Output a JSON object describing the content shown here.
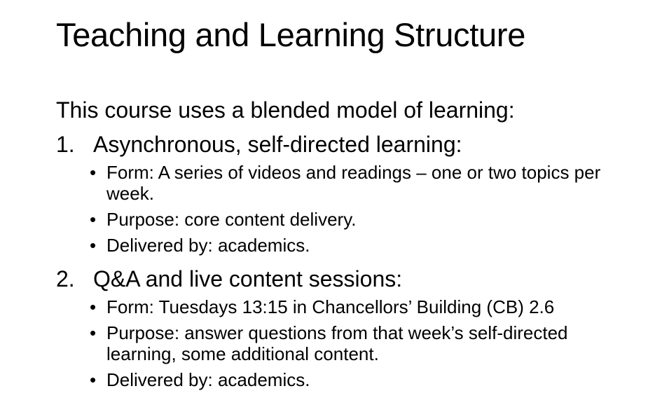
{
  "slide": {
    "title": "Teaching and Learning Structure",
    "intro": "This course uses a blended model of learning:",
    "sections": [
      {
        "number": "1.",
        "heading": "Asynchronous, self-directed learning:",
        "bullets": [
          "Form: A series of videos and readings – one or two topics per week.",
          "Purpose: core content delivery.",
          "Delivered by: academics."
        ]
      },
      {
        "number": "2.",
        "heading": "Q&A and live content sessions:",
        "bullets": [
          "Form: Tuesdays 13:15 in Chancellors’ Building (CB) 2.6",
          "Purpose: answer questions from that week’s self-directed learning, some additional content.",
          "Delivered by: academics."
        ]
      }
    ],
    "bullet_glyph": "•"
  }
}
